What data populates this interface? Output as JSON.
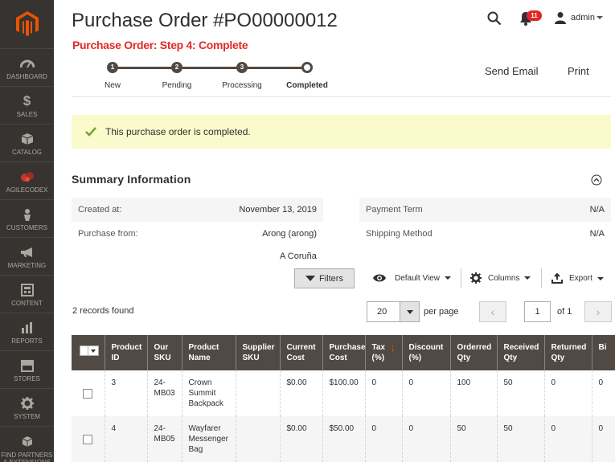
{
  "sidebar": {
    "items": [
      {
        "label": "Dashboard",
        "icon": "dashboard-icon"
      },
      {
        "label": "Sales",
        "icon": "dollar-icon"
      },
      {
        "label": "Catalog",
        "icon": "box-icon"
      },
      {
        "label": "AgileCodex",
        "icon": "agilecodex-icon"
      },
      {
        "label": "Customers",
        "icon": "person-icon"
      },
      {
        "label": "Marketing",
        "icon": "megaphone-icon"
      },
      {
        "label": "Content",
        "icon": "content-icon"
      },
      {
        "label": "Reports",
        "icon": "bar-chart-icon"
      },
      {
        "label": "Stores",
        "icon": "store-icon"
      },
      {
        "label": "System",
        "icon": "gear-icon"
      },
      {
        "label": "Find Partners & Extensions",
        "icon": "cubes-icon"
      }
    ]
  },
  "header": {
    "title": "Purchase Order #PO00000012",
    "notifications_count": "11",
    "user": "admin"
  },
  "step_heading": "Purchase Order: Step 4: Complete",
  "steps": [
    {
      "num": "1",
      "label": "New"
    },
    {
      "num": "2",
      "label": "Pending"
    },
    {
      "num": "3",
      "label": "Processing"
    },
    {
      "num": "",
      "label": "Completed"
    }
  ],
  "actions": {
    "send_email": "Send Email",
    "print": "Print"
  },
  "message": "This purchase order is completed.",
  "summary": {
    "title": "Summary Information",
    "left": [
      {
        "label": "Created at:",
        "value": "November 13, 2019"
      },
      {
        "label": "Purchase from:",
        "value": "Arong (arong)"
      }
    ],
    "left_extra": "A Coruña",
    "right": [
      {
        "label": "Payment Term",
        "value": "N/A"
      },
      {
        "label": "Shipping Method",
        "value": "N/A"
      }
    ]
  },
  "grid_controls": {
    "filters": "Filters",
    "view": "Default View",
    "columns": "Columns",
    "export": "Export",
    "records_found": "2 records found",
    "per_page_value": "20",
    "per_page_label": "per page",
    "page": "1",
    "of_pages": "of 1"
  },
  "table": {
    "headers": [
      "Product ID",
      "Our SKU",
      "Product Name",
      "Supplier SKU",
      "Current Cost",
      "Purchase Cost",
      "Tax (%)",
      "Discount (%)",
      "Orderred Qty",
      "Received Qty",
      "Returned Qty",
      "Bi"
    ],
    "rows": [
      [
        "3",
        "24-MB03",
        "Crown Summit Backpack",
        "",
        "$0.00",
        "$100.00",
        "0",
        "0",
        "100",
        "50",
        "0",
        "0"
      ],
      [
        "4",
        "24-MB05",
        "Wayfarer Messenger Bag",
        "",
        "$0.00",
        "$50.00",
        "0",
        "0",
        "50",
        "50",
        "0",
        "0"
      ]
    ]
  },
  "colors": {
    "sidebar": "#373330",
    "accent": "#eb5202",
    "header_row": "#514943",
    "alert": "#e02b27",
    "message_bg": "#fafacc"
  }
}
